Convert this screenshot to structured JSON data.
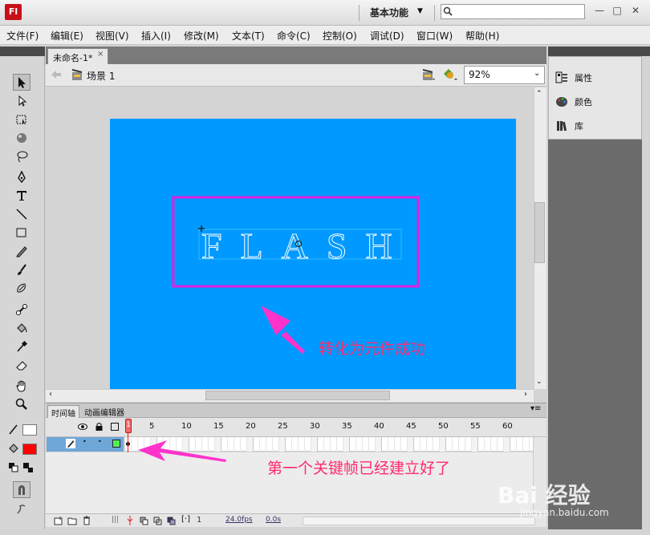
{
  "app": {
    "logo_text": "Fl",
    "workspace": "基本功能",
    "win_min": "—",
    "win_max": "□",
    "win_close": "✕"
  },
  "menu": [
    "文件(F)",
    "编辑(E)",
    "视图(V)",
    "插入(I)",
    "修改(M)",
    "文本(T)",
    "命令(C)",
    "控制(O)",
    "调试(D)",
    "窗口(W)",
    "帮助(H)"
  ],
  "document": {
    "tab_label": "未命名-1*",
    "close": "×",
    "scene_label": "场景 1",
    "zoom": "92%"
  },
  "stage": {
    "bg_color": "#0099ff",
    "text": "FLASH",
    "selection_color": "#e020e0"
  },
  "timeline": {
    "tabs": [
      "时间轴",
      "动画编辑器"
    ],
    "frame_numbers": [
      "1",
      "5",
      "10",
      "15",
      "20",
      "25",
      "30",
      "35",
      "40",
      "45",
      "50",
      "55",
      "60"
    ],
    "current_frame": "1",
    "fps": "24.0fps",
    "time": "0.0s"
  },
  "right_panel": {
    "items": [
      "属性",
      "颜色",
      "库"
    ]
  },
  "annotations": {
    "note1": "转化为元件成功",
    "note2": "第一个关键帧已经建立好了",
    "color": "#ff2b6e"
  },
  "watermark": {
    "brand": "Bai 经验",
    "url": "jingyan.baidu.com"
  }
}
